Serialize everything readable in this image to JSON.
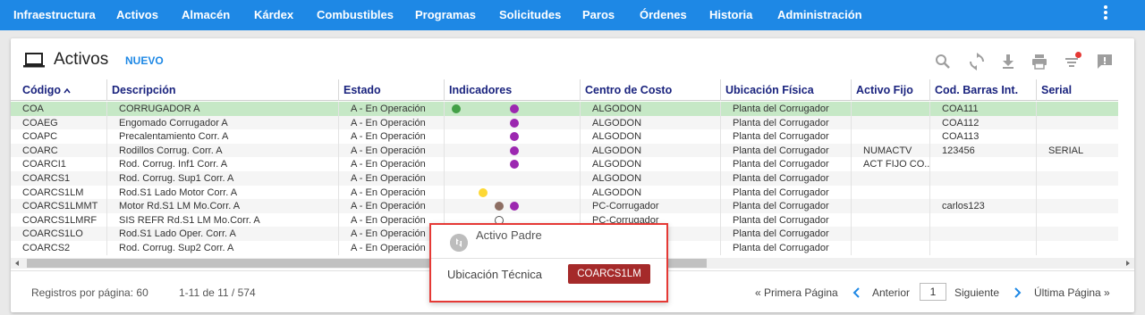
{
  "nav": {
    "items": [
      "Infraestructura",
      "Activos",
      "Almacén",
      "Kárdex",
      "Combustibles",
      "Programas",
      "Solicitudes",
      "Paros",
      "Órdenes",
      "Historia",
      "Administración"
    ],
    "bg_color": "#1e88e5"
  },
  "header": {
    "title": "Activos",
    "new_label": "NUEVO",
    "icon": "laptop-icon",
    "tools": [
      "search-icon",
      "refresh-icon",
      "download-icon",
      "print-icon",
      "filter-icon",
      "comment-icon"
    ]
  },
  "table": {
    "columns": [
      "Código",
      "Descripción",
      "Estado",
      "Indicadores",
      "Centro de Costo",
      "Ubicación Física",
      "Activo Fijo",
      "Cod. Barras Int.",
      "Serial"
    ],
    "rows": [
      {
        "codigo": "COA",
        "descripcion": "CORRUGADOR A",
        "estado": "A - En Operación",
        "indicadores": [
          "green",
          "purple"
        ],
        "centro": "ALGODON",
        "ubicacion": "Planta del Corrugador",
        "activo_fijo": "",
        "cod_barras": "COA111",
        "serial": "",
        "selected": true
      },
      {
        "codigo": "COAEG",
        "descripcion": "Engomado Corrugador A",
        "estado": "A - En Operación",
        "indicadores": [
          "purple"
        ],
        "centro": "ALGODON",
        "ubicacion": "Planta del Corrugador",
        "activo_fijo": "",
        "cod_barras": "COA112",
        "serial": ""
      },
      {
        "codigo": "COAPC",
        "descripcion": "Precalentamiento Corr. A",
        "estado": "A - En Operación",
        "indicadores": [
          "purple"
        ],
        "centro": "ALGODON",
        "ubicacion": "Planta del Corrugador",
        "activo_fijo": "",
        "cod_barras": "COA113",
        "serial": ""
      },
      {
        "codigo": "COARC",
        "descripcion": "Rodillos Corrug. Corr. A",
        "estado": "A - En Operación",
        "indicadores": [
          "purple"
        ],
        "centro": "ALGODON",
        "ubicacion": "Planta del Corrugador",
        "activo_fijo": "NUMACTV",
        "cod_barras": "123456",
        "serial": "SERIAL"
      },
      {
        "codigo": "COARCI1",
        "descripcion": "Rod. Corrug. Inf1 Corr. A",
        "estado": "A - En Operación",
        "indicadores": [
          "purple"
        ],
        "centro": "ALGODON",
        "ubicacion": "Planta del Corrugador",
        "activo_fijo": "ACT FIJO CO...",
        "cod_barras": "",
        "serial": ""
      },
      {
        "codigo": "COARCS1",
        "descripcion": "Rod. Corrug. Sup1 Corr. A",
        "estado": "A - En Operación",
        "indicadores": [],
        "centro": "ALGODON",
        "ubicacion": "Planta del Corrugador",
        "activo_fijo": "",
        "cod_barras": "",
        "serial": ""
      },
      {
        "codigo": "COARCS1LM",
        "descripcion": "Rod.S1 Lado Motor Corr. A",
        "estado": "A - En Operación",
        "indicadores": [
          "yellow"
        ],
        "centro": "ALGODON",
        "ubicacion": "Planta del Corrugador",
        "activo_fijo": "",
        "cod_barras": "",
        "serial": ""
      },
      {
        "codigo": "COARCS1LMMT",
        "descripcion": "Motor Rd.S1 LM Mo.Corr. A",
        "estado": "A - En Operación",
        "indicadores": [
          "brown",
          "purple"
        ],
        "centro": "PC-Corrugador",
        "ubicacion": "Planta del Corrugador",
        "activo_fijo": "",
        "cod_barras": "carlos123",
        "serial": ""
      },
      {
        "codigo": "COARCS1LMRF",
        "descripcion": "SIS REFR Rd.S1 LM Mo.Corr. A",
        "estado": "A - En Operación",
        "indicadores": [
          "ring"
        ],
        "centro": "PC-Corrugador",
        "ubicacion": "Planta del Corrugador",
        "activo_fijo": "",
        "cod_barras": "",
        "serial": ""
      },
      {
        "codigo": "COARCS1LO",
        "descripcion": "Rod.S1 Lado Oper. Corr. A",
        "estado": "A - En Operación",
        "indicadores": [],
        "centro": "",
        "ubicacion": "Planta del Corrugador",
        "activo_fijo": "",
        "cod_barras": "",
        "serial": ""
      },
      {
        "codigo": "COARCS2",
        "descripcion": "Rod. Corrug. Sup2 Corr. A",
        "estado": "A - En Operación",
        "indicadores": [],
        "centro": "",
        "ubicacion": "Planta del Corrugador",
        "activo_fijo": "",
        "cod_barras": "",
        "serial": ""
      }
    ],
    "indicator_colors": {
      "green": "#43a047",
      "purple": "#9c27b0",
      "yellow": "#fdd835",
      "brown": "#8d6e63"
    },
    "selected_color": "#c6e8c6"
  },
  "footer": {
    "per_page_label": "Registros por página: 60",
    "range_label": "1-11 de 11 / 574",
    "first_label": "« Primera Página",
    "prev_label": "Anterior",
    "page_value": "1",
    "next_label": "Siguiente",
    "last_label": "Última Página »"
  },
  "popup": {
    "title": "Activo Padre",
    "label": "Ubicación Técnica",
    "button": "COARCS1LM",
    "border_color": "#e53935",
    "button_color": "#a52a2a"
  }
}
